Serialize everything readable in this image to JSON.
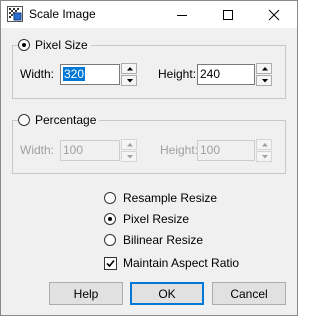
{
  "window": {
    "title": "Scale Image",
    "icon": "scale-image-app-icon"
  },
  "title_bar_buttons": {
    "minimize_icon": "minimize-icon",
    "maximize_icon": "maximize-icon",
    "close_icon": "close-icon"
  },
  "pixel_size": {
    "label": "Pixel Size",
    "selected": true,
    "width_label": "Width:",
    "width_value": "320",
    "height_label": "Height:",
    "height_value": "240"
  },
  "percentage": {
    "label": "Percentage",
    "selected": false,
    "width_label": "Width:",
    "width_value": "100",
    "height_label": "Height:",
    "height_value": "100"
  },
  "resize_methods": [
    {
      "label": "Resample Resize",
      "selected": false
    },
    {
      "label": "Pixel Resize",
      "selected": true
    },
    {
      "label": "Bilinear Resize",
      "selected": false
    }
  ],
  "maintain_aspect": {
    "label": "Maintain Aspect Ratio",
    "checked": true
  },
  "buttons": {
    "help": "Help",
    "ok": "OK",
    "cancel": "Cancel"
  },
  "colors": {
    "selection": "#0078d7",
    "default_button_border": "#0078d7",
    "disabled_text": "#a0a0a0"
  }
}
